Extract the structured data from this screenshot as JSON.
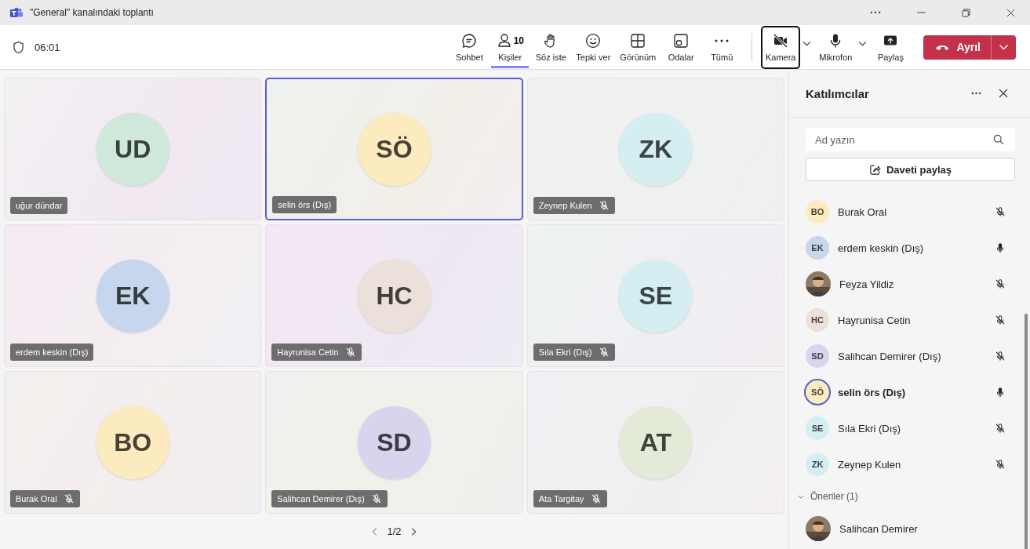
{
  "window": {
    "title": "\"General\" kanalındaki toplantı"
  },
  "meeting": {
    "timer": "06:01"
  },
  "toolbar": [
    {
      "kind": "chat",
      "label": "Sohbet",
      "selected": false,
      "focused": false
    },
    {
      "kind": "people",
      "label": "Kişiler",
      "badge": "10",
      "selected": true,
      "focused": false
    },
    {
      "kind": "hand",
      "label": "Söz iste",
      "selected": false,
      "focused": false
    },
    {
      "kind": "smile",
      "label": "Tepki ver",
      "selected": false,
      "focused": false
    },
    {
      "kind": "grid",
      "label": "Görünüm",
      "selected": false,
      "focused": false
    },
    {
      "kind": "rooms",
      "label": "Odalar",
      "selected": false,
      "focused": false
    },
    {
      "kind": "more",
      "label": "Tümü",
      "selected": false,
      "focused": false
    },
    {
      "kind": "camera",
      "label": "Kamera",
      "selected": false,
      "focused": true
    },
    {
      "kind": "mic",
      "label": "Mikrofon",
      "selected": false,
      "focused": false
    },
    {
      "kind": "share",
      "label": "Paylaş",
      "selected": false,
      "focused": false
    }
  ],
  "leave_button": {
    "label": "Ayrıl"
  },
  "tiles": [
    {
      "initials": "UD",
      "name": "uğur dündar",
      "muted": false,
      "selected": false,
      "color": "#cfe8da"
    },
    {
      "initials": "SÖ",
      "name": "selin örs (Dış)",
      "muted": false,
      "selected": true,
      "color": "#fcebbf"
    },
    {
      "initials": "ZK",
      "name": "Zeynep Kulen",
      "muted": true,
      "selected": false,
      "color": "#d5eef2"
    },
    {
      "initials": "EK",
      "name": "erdem keskin (Dış)",
      "muted": false,
      "selected": false,
      "color": "#c6d6ec"
    },
    {
      "initials": "HC",
      "name": "Hayrunisa Cetin",
      "muted": true,
      "selected": false,
      "color": "#ebe0da"
    },
    {
      "initials": "SE",
      "name": "Sıla Ekri (Dış)",
      "muted": true,
      "selected": false,
      "color": "#d5eef2"
    },
    {
      "initials": "BO",
      "name": "Burak Oral",
      "muted": true,
      "selected": false,
      "color": "#fcebbf"
    },
    {
      "initials": "SD",
      "name": "Salihcan Demirer (Dış)",
      "muted": true,
      "selected": false,
      "color": "#d7d4ee"
    },
    {
      "initials": "AT",
      "name": "Ata Targitay",
      "muted": true,
      "selected": false,
      "color": "#e3ebd8"
    }
  ],
  "pagination": {
    "page": "1/2"
  },
  "participants_panel": {
    "title": "Katılımcılar",
    "search": {
      "placeholder": "Ad yazın"
    },
    "invite_button": "Daveti paylaş",
    "participants": [
      {
        "kind": "initials",
        "initials": "BO",
        "name": "Burak Oral",
        "muted": true,
        "speaking": false,
        "color": "#fcebbf"
      },
      {
        "kind": "initials",
        "initials": "EK",
        "name": "erdem keskin (Dış)",
        "muted": false,
        "speaking": false,
        "color": "#c6d6ec"
      },
      {
        "kind": "picture",
        "name": "Feyza Yildiz",
        "muted": true,
        "speaking": false
      },
      {
        "kind": "initials",
        "initials": "HC",
        "name": "Hayrunisa Cetin",
        "muted": true,
        "speaking": false,
        "color": "#ebe0da"
      },
      {
        "kind": "initials",
        "initials": "SD",
        "name": "Salihcan Demirer (Dış)",
        "muted": true,
        "speaking": false,
        "color": "#d7d4ee"
      },
      {
        "kind": "initials",
        "initials": "SÖ",
        "name": "selin örs (Dış)",
        "muted": false,
        "speaking": true,
        "color": "#fcebbf"
      },
      {
        "kind": "initials",
        "initials": "SE",
        "name": "Sıla Ekri (Dış)",
        "muted": true,
        "speaking": false,
        "color": "#d5eef2"
      },
      {
        "kind": "initials",
        "initials": "ZK",
        "name": "Zeynep Kulen",
        "muted": true,
        "speaking": false,
        "color": "#d5eef2"
      }
    ],
    "suggestions": {
      "label": "Öneriler (1)",
      "expanded": true,
      "people": [
        {
          "kind": "picture",
          "name": "Salihcan Demirer"
        }
      ]
    }
  }
}
